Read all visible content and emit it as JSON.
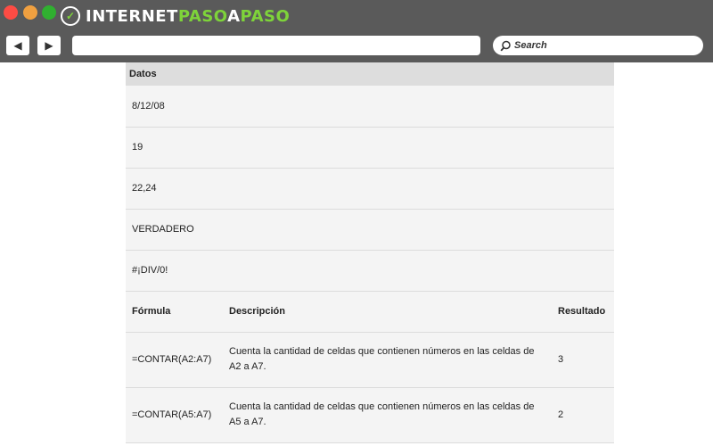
{
  "browser": {
    "logo_part1": "INTERNET",
    "logo_part2": "PASO",
    "logo_part3": "A",
    "logo_part4": "PASO",
    "back_label": "◀",
    "forward_label": "▶",
    "url_value": "",
    "search_placeholder": "Search"
  },
  "colors": {
    "titlebar": "#5a5a5a",
    "close": "#fe4c44",
    "minimize": "#f0a040",
    "maximize": "#30b030",
    "logo_accent": "#7ed33a"
  },
  "table": {
    "data_header": "Datos",
    "data_rows": [
      "8/12/08",
      "19",
      "22,24",
      "VERDADERO",
      "#¡DIV/0!"
    ],
    "formula_headers": [
      "Fórmula",
      "Descripción",
      "Resultado"
    ],
    "formula_rows": [
      {
        "formula": "=CONTAR(A2:A7)",
        "description": "Cuenta la cantidad de celdas que contienen números en las celdas de A2 a A7.",
        "result": "3"
      },
      {
        "formula": "=CONTAR(A5:A7)",
        "description": "Cuenta la cantidad de celdas que contienen números en las celdas de A5 a A7.",
        "result": "2"
      }
    ]
  }
}
